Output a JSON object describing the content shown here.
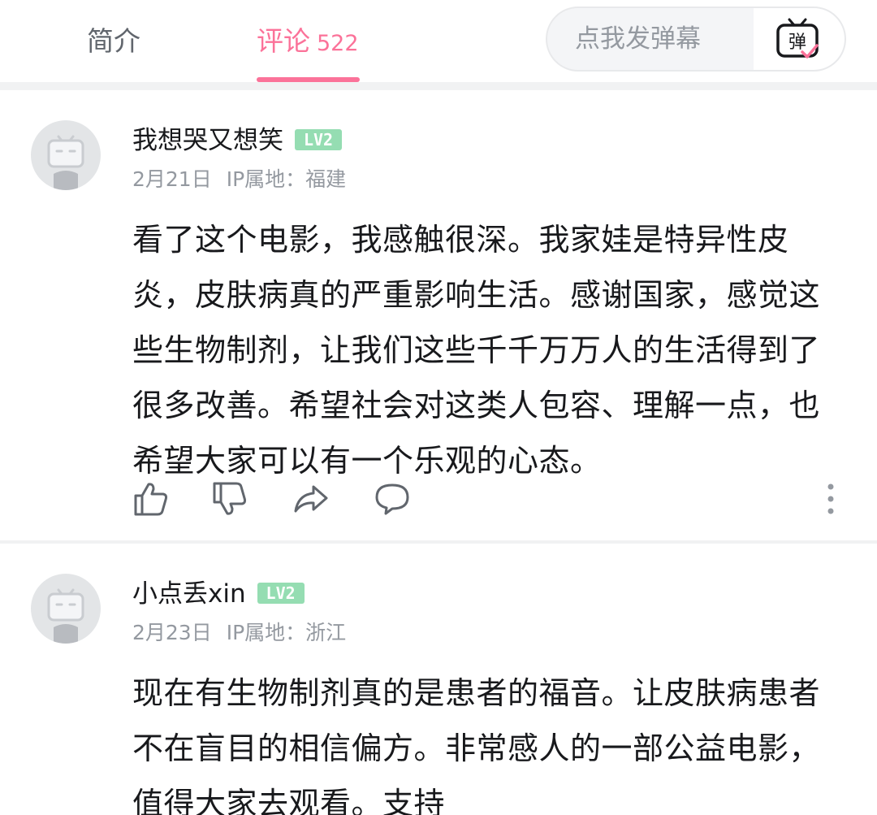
{
  "tabs": {
    "intro_label": "简介",
    "comments_label": "评论",
    "comments_count": "522"
  },
  "danmaku": {
    "placeholder": "点我发弹幕",
    "button_glyph": "弹"
  },
  "colors": {
    "accent": "#fb7299",
    "level_badge": "#95ddb2",
    "secondary_text": "#9499a0"
  },
  "comments": [
    {
      "username": "我想哭又想笑",
      "level": "LV2",
      "date": "2月21日",
      "ip": "IP属地：福建",
      "content": "看了这个电影，我感触很深。我家娃是特异性皮炎，皮肤病真的严重影响生活。感谢国家，感觉这些生物制剂，让我们这些千千万万人的生活得到了很多改善。希望社会对这类人包容、理解一点，也希望大家可以有一个乐观的心态。",
      "action_icons": [
        "thumbs-up-icon",
        "thumbs-down-icon",
        "share-icon",
        "reply-icon",
        "more-icon"
      ]
    },
    {
      "username": "小点丢xin",
      "level": "LV2",
      "date": "2月23日",
      "ip": "IP属地：浙江",
      "content": "现在有生物制剂真的是患者的福音。让皮肤病患者不在盲目的相信偏方。非常感人的一部公益电影，值得大家去观看。支持"
    }
  ]
}
